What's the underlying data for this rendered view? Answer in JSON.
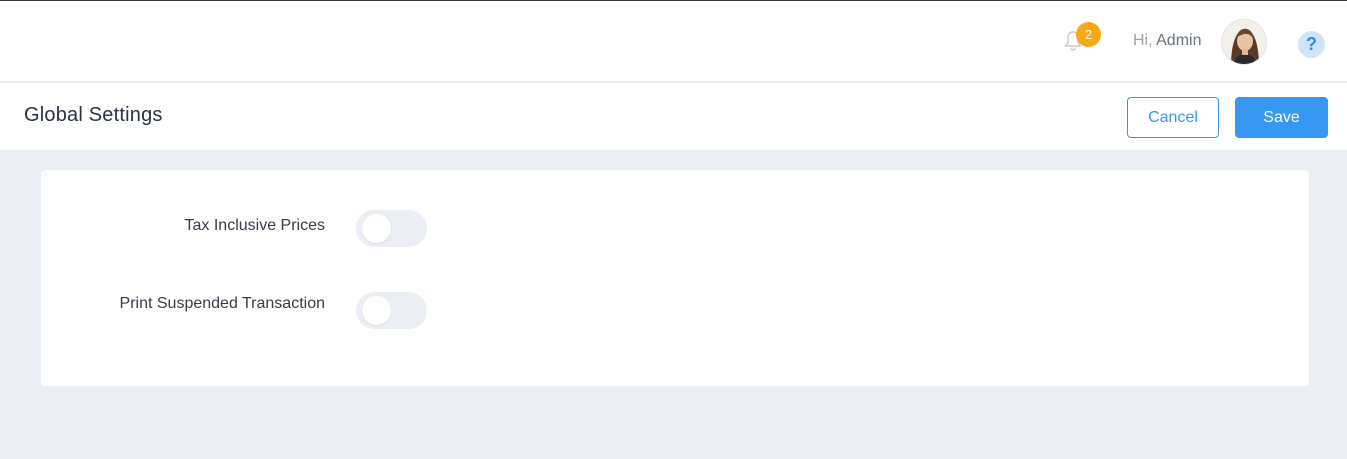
{
  "topbar": {
    "notifications_count": "2",
    "greeting_prefix": "Hi,",
    "user_name": "Admin",
    "help_symbol": "?",
    "icons": [
      "bell-icon",
      "help-icon"
    ]
  },
  "header": {
    "title": "Global Settings",
    "cancel_label": "Cancel",
    "save_label": "Save"
  },
  "settings": {
    "items": [
      {
        "label": "Tax Inclusive Prices",
        "enabled": false
      },
      {
        "label": "Print Suspended Transaction",
        "enabled": false
      }
    ]
  },
  "colors": {
    "primary": "#3698f2",
    "badge": "#f7a816",
    "background": "#eceef5"
  }
}
